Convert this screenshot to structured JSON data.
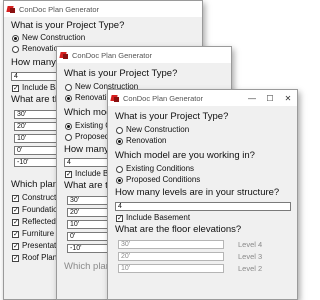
{
  "app_title": "ConDoc Plan Generator",
  "controls": {
    "minimize": "—",
    "maximize": "☐",
    "close": "✕"
  },
  "w1": {
    "project_type_q": "What is your Project Type?",
    "new_construction": "New Construction",
    "renovation": "Renovation",
    "levels_q": "How many le",
    "levels_value": "4",
    "include_basement": "Include Ba",
    "elev_q": "What are th",
    "elevations": [
      "30'",
      "20'",
      "10'",
      "0'",
      "-10'"
    ],
    "plans_q": "Which plans",
    "plans": [
      "Construct",
      "Foundatio",
      "Reflected",
      "Furniture",
      "Presentat",
      "Roof Plan"
    ]
  },
  "w2": {
    "project_type_q": "What is your Project Type?",
    "new_construction": "New Construction",
    "renovation": "Renovatio",
    "model_q": "Which mod",
    "existing": "Existing C",
    "proposed": "Proposed",
    "levels_q": "How many",
    "levels_value": "4",
    "include_basement": "Include Ba",
    "elev_q": "What are th",
    "elevations": [
      "30'",
      "20'",
      "10'",
      "0'",
      "-10'"
    ],
    "plans_q": "Which plans"
  },
  "w3": {
    "project_type_q": "What is your Project Type?",
    "new_construction": "New Construction",
    "renovation": "Renovation",
    "model_q": "Which model are you working in?",
    "existing": "Existing Conditions",
    "proposed": "Proposed Conditions",
    "levels_q": "How many levels are in your structure?",
    "levels_value": "4",
    "include_basement": "Include Basement",
    "elev_q": "What are the floor elevations?",
    "elevations": [
      "30'",
      "20'",
      "10'"
    ],
    "level_labels": [
      "Level 4",
      "Level 3",
      "Level 2"
    ]
  }
}
